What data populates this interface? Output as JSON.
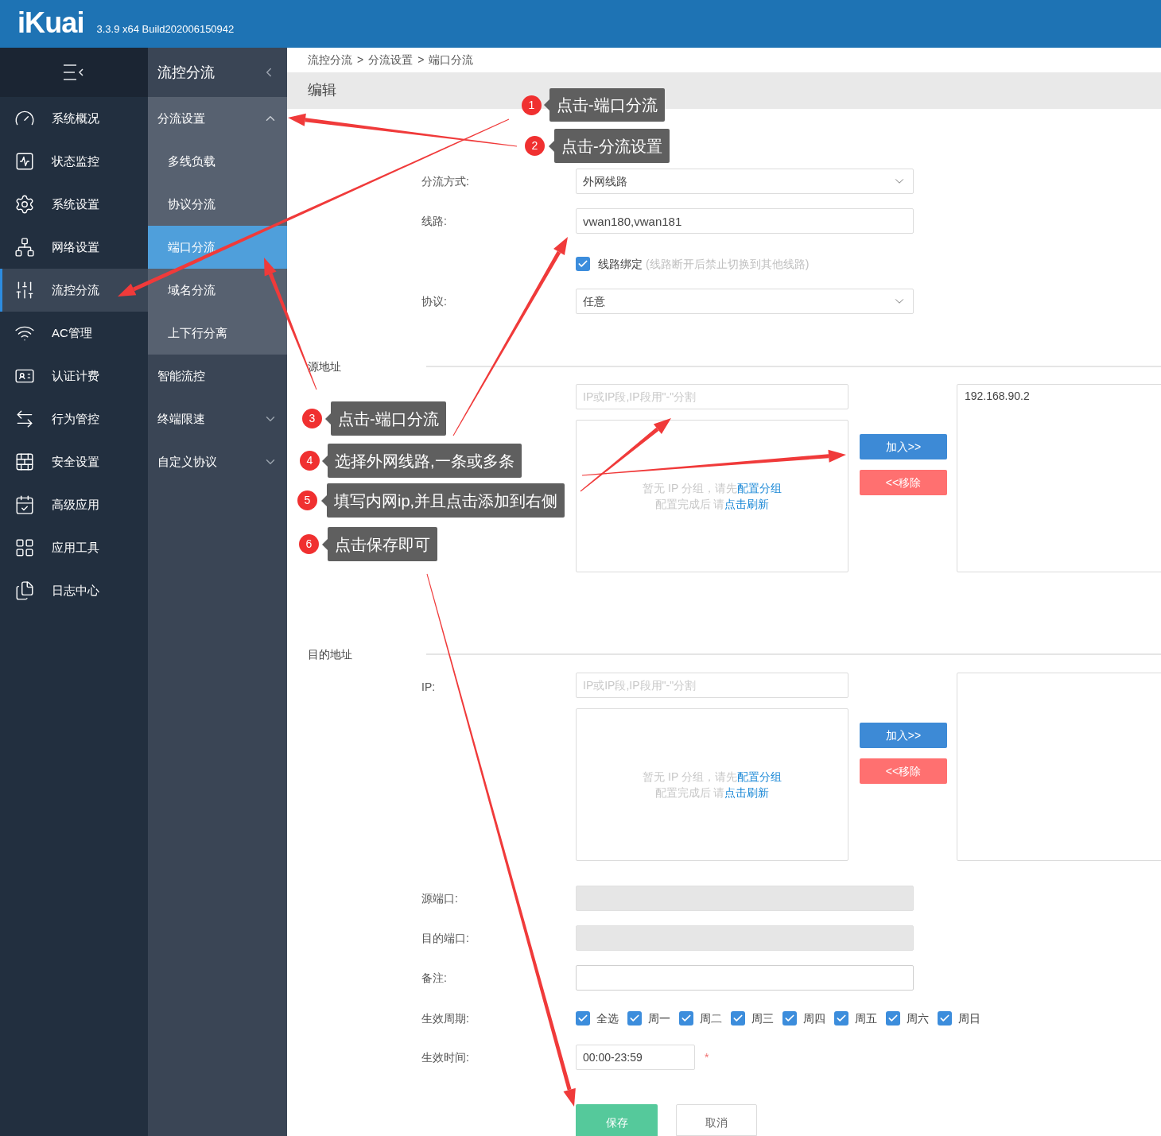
{
  "header": {
    "logo": "iKuai",
    "version": "3.3.9 x64 Build202006150942"
  },
  "sidebar": {
    "items": [
      {
        "label": "系统概况",
        "selected": false
      },
      {
        "label": "状态监控",
        "selected": false
      },
      {
        "label": "系统设置",
        "selected": false
      },
      {
        "label": "网络设置",
        "selected": false
      },
      {
        "label": "流控分流",
        "selected": true
      },
      {
        "label": "AC管理",
        "selected": false
      },
      {
        "label": "认证计费",
        "selected": false
      },
      {
        "label": "行为管控",
        "selected": false
      },
      {
        "label": "安全设置",
        "selected": false
      },
      {
        "label": "高级应用",
        "selected": false
      },
      {
        "label": "应用工具",
        "selected": false
      },
      {
        "label": "日志中心",
        "selected": false
      }
    ]
  },
  "submenu": {
    "title": "流控分流",
    "items": [
      {
        "label": "分流设置",
        "expanded": true,
        "children": [
          {
            "label": "多线负载",
            "selected": false
          },
          {
            "label": "协议分流",
            "selected": false
          },
          {
            "label": "端口分流",
            "selected": true
          },
          {
            "label": "域名分流",
            "selected": false
          },
          {
            "label": "上下行分离",
            "selected": false
          }
        ]
      },
      {
        "label": "智能流控"
      },
      {
        "label": "终端限速",
        "expanded": false
      },
      {
        "label": "自定义协议",
        "expanded": false
      }
    ]
  },
  "breadcrumb": {
    "items": [
      "流控分流",
      "分流设置",
      "端口分流"
    ],
    "separator": ">"
  },
  "page_title": "编辑",
  "form": {
    "split_mode": {
      "label": "分流方式:",
      "value": "外网线路"
    },
    "line": {
      "label": "线路:",
      "value": "vwan180,vwan181"
    },
    "bind": {
      "label": "线路绑定",
      "hint": "(线路断开后禁止切换到其他线路)",
      "checked": true
    },
    "protocol": {
      "label": "协议:",
      "value": "任意"
    }
  },
  "source": {
    "heading": "源地址",
    "ip_placeholder": "IP或IP段,IP段用\"-\"分割",
    "empty_text": "暂无 IP 分组，请先",
    "config_link": "配置分组",
    "refresh_text": "配置完成后 请",
    "refresh_link": "点击刷新",
    "add_button": "加入>>",
    "remove_button": "<<移除",
    "selected_ips": [
      "192.168.90.2"
    ]
  },
  "destination": {
    "heading": "目的地址",
    "ip_label": "IP:",
    "ip_placeholder": "IP或IP段,IP段用\"-\"分割",
    "empty_text": "暂无 IP 分组，请先",
    "config_link": "配置分组",
    "refresh_text": "配置完成后 请",
    "refresh_link": "点击刷新",
    "add_button": "加入>>",
    "remove_button": "<<移除"
  },
  "ports": [
    {
      "label": "源端口:",
      "disabled": true
    },
    {
      "label": "目的端口:",
      "disabled": true
    },
    {
      "label": "备注:",
      "disabled": false
    }
  ],
  "days": {
    "label": "生效周期:",
    "items": [
      {
        "label": "全选",
        "checked": true
      },
      {
        "label": "周一",
        "checked": true
      },
      {
        "label": "周二",
        "checked": true
      },
      {
        "label": "周三",
        "checked": true
      },
      {
        "label": "周四",
        "checked": true
      },
      {
        "label": "周五",
        "checked": true
      },
      {
        "label": "周六",
        "checked": true
      },
      {
        "label": "周日",
        "checked": true
      }
    ]
  },
  "time": {
    "label": "生效时间:",
    "value": "00:00-23:59",
    "required": true,
    "required_mark": "*"
  },
  "buttons": {
    "save": "保存",
    "cancel": "取消"
  },
  "annotations": [
    {
      "number": "1",
      "text": "点击-端口分流"
    },
    {
      "number": "2",
      "text": "点击-分流设置"
    },
    {
      "number": "3",
      "text": "点击-端口分流"
    },
    {
      "number": "4",
      "text": "选择外网线路,一条或多条"
    },
    {
      "number": "5",
      "text": "填写内网ip,并且点击添加到右侧"
    },
    {
      "number": "6",
      "text": "点击保存即可"
    }
  ]
}
